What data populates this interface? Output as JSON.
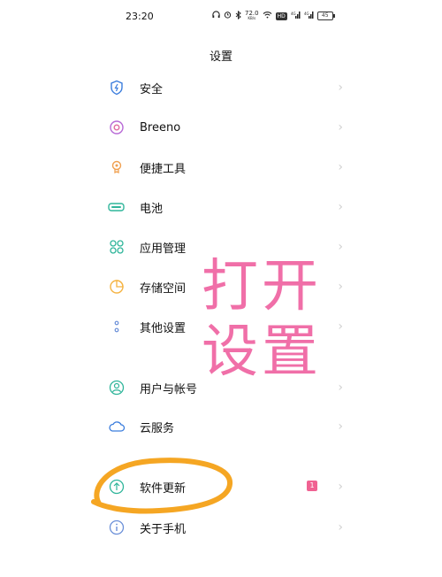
{
  "status": {
    "time": "23:20",
    "net_speed": "72.0",
    "net_unit": "KB/s",
    "vo_label": "HD",
    "signal1": "4G",
    "signal2": "4G",
    "battery": "45"
  },
  "header": {
    "title": "设置"
  },
  "settings": {
    "items": [
      {
        "label": "安全",
        "icon": "shield-icon"
      },
      {
        "label": "Breeno",
        "icon": "breeno-icon"
      },
      {
        "label": "便捷工具",
        "icon": "tools-icon"
      },
      {
        "label": "电池",
        "icon": "battery-icon"
      },
      {
        "label": "应用管理",
        "icon": "apps-icon"
      },
      {
        "label": "存储空间",
        "icon": "storage-icon"
      },
      {
        "label": "其他设置",
        "icon": "more-settings-icon"
      },
      {
        "label": "用户与帐号",
        "icon": "user-icon"
      },
      {
        "label": "云服务",
        "icon": "cloud-icon"
      },
      {
        "label": "软件更新",
        "icon": "update-icon",
        "badge": "1"
      },
      {
        "label": "关于手机",
        "icon": "info-icon"
      }
    ]
  },
  "overlay": {
    "line1": "打开",
    "line2": "设置"
  },
  "colors": {
    "accent_pink": "#f06fa8",
    "highlight_ring": "#f5a623",
    "badge": "#f06292"
  }
}
